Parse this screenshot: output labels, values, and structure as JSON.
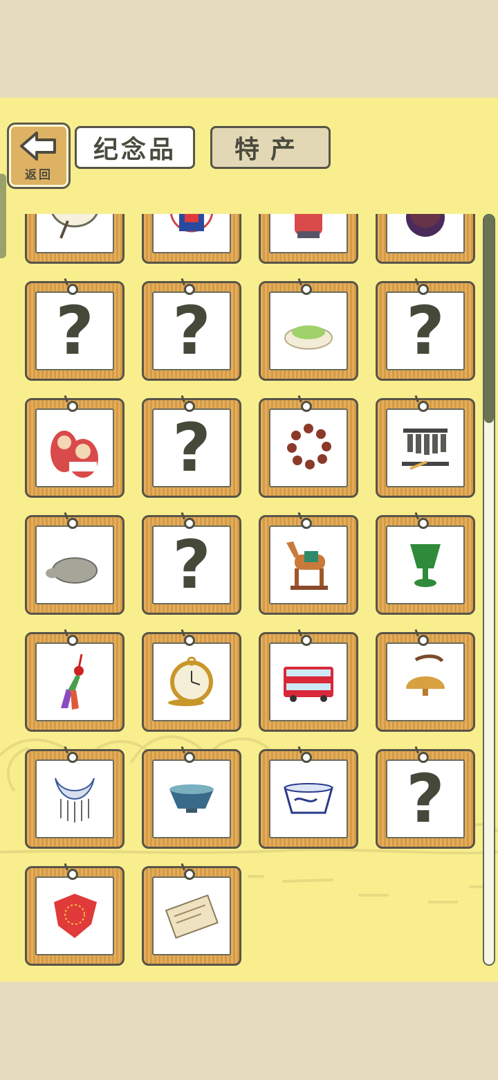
{
  "header": {
    "back_label": "返回",
    "tabs": [
      {
        "label": "纪念品",
        "active": true
      },
      {
        "label": "特产",
        "active": false
      }
    ]
  },
  "grid": {
    "unknown_symbol": "?",
    "items": [
      {
        "name": "folding-fan",
        "known": true
      },
      {
        "name": "lucky-cat-fu",
        "known": true
      },
      {
        "name": "red-doll",
        "known": true
      },
      {
        "name": "purple-vase",
        "known": true
      },
      {
        "name": "unknown",
        "known": false
      },
      {
        "name": "unknown",
        "known": false
      },
      {
        "name": "matcha-powder-bowl",
        "known": true
      },
      {
        "name": "unknown",
        "known": false
      },
      {
        "name": "matryoshka-dolls",
        "known": true
      },
      {
        "name": "unknown",
        "known": false
      },
      {
        "name": "prayer-beads",
        "known": true
      },
      {
        "name": "chime-bells",
        "known": true
      },
      {
        "name": "stone-turtle",
        "known": true
      },
      {
        "name": "unknown",
        "known": false
      },
      {
        "name": "tang-horse",
        "known": true
      },
      {
        "name": "jade-cup",
        "known": true
      },
      {
        "name": "chinese-knot-tassel",
        "known": true
      },
      {
        "name": "pocket-watch",
        "known": true
      },
      {
        "name": "double-decker-bus",
        "known": true
      },
      {
        "name": "cowbell",
        "known": true
      },
      {
        "name": "silver-necklace",
        "known": true
      },
      {
        "name": "tea-bowl",
        "known": true
      },
      {
        "name": "blue-white-cup",
        "known": true
      },
      {
        "name": "unknown",
        "known": false
      },
      {
        "name": "red-handkerchief",
        "known": true
      },
      {
        "name": "paper-document",
        "known": true
      }
    ]
  },
  "colors": {
    "background": "#f8ee8e",
    "frame_wood": "#e3ae5d",
    "outline": "#585447"
  }
}
